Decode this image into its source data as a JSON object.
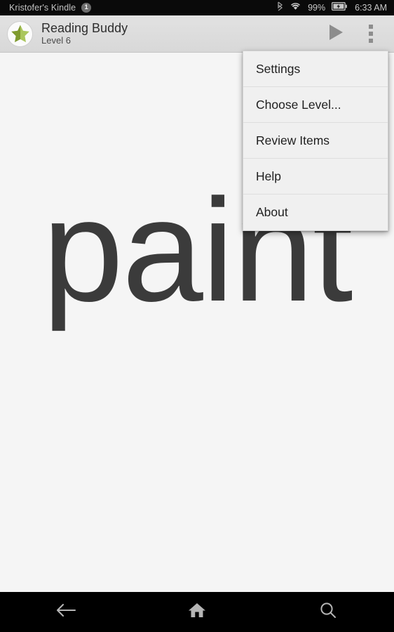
{
  "status_bar": {
    "device_name": "Kristofer's Kindle",
    "notification_count": "1",
    "bluetooth_icon": "bluetooth-icon",
    "wifi_icon": "wifi-icon",
    "battery_percent": "99%",
    "battery_icon": "battery-charging-icon",
    "clock": "6:33 AM"
  },
  "app_bar": {
    "icon": "star-app-icon",
    "title": "Reading Buddy",
    "subtitle": "Level 6",
    "play_icon": "play-icon",
    "overflow_icon": "overflow-menu-icon"
  },
  "content": {
    "word": "paint"
  },
  "overflow_menu": {
    "items": [
      {
        "label": "Settings"
      },
      {
        "label": "Choose Level..."
      },
      {
        "label": "Review Items"
      },
      {
        "label": "Help"
      },
      {
        "label": "About"
      }
    ]
  },
  "nav_bar": {
    "back_icon": "back-arrow-icon",
    "home_icon": "home-icon",
    "search_icon": "search-icon"
  },
  "colors": {
    "star_dark_green": "#7f9a2e",
    "star_light_green": "#a8c65a",
    "word_text": "#3b3b3b",
    "app_bar_bg": "#dcdcdc",
    "menu_bg": "#f0f0f0",
    "nav_icon": "#b5b5b5"
  }
}
